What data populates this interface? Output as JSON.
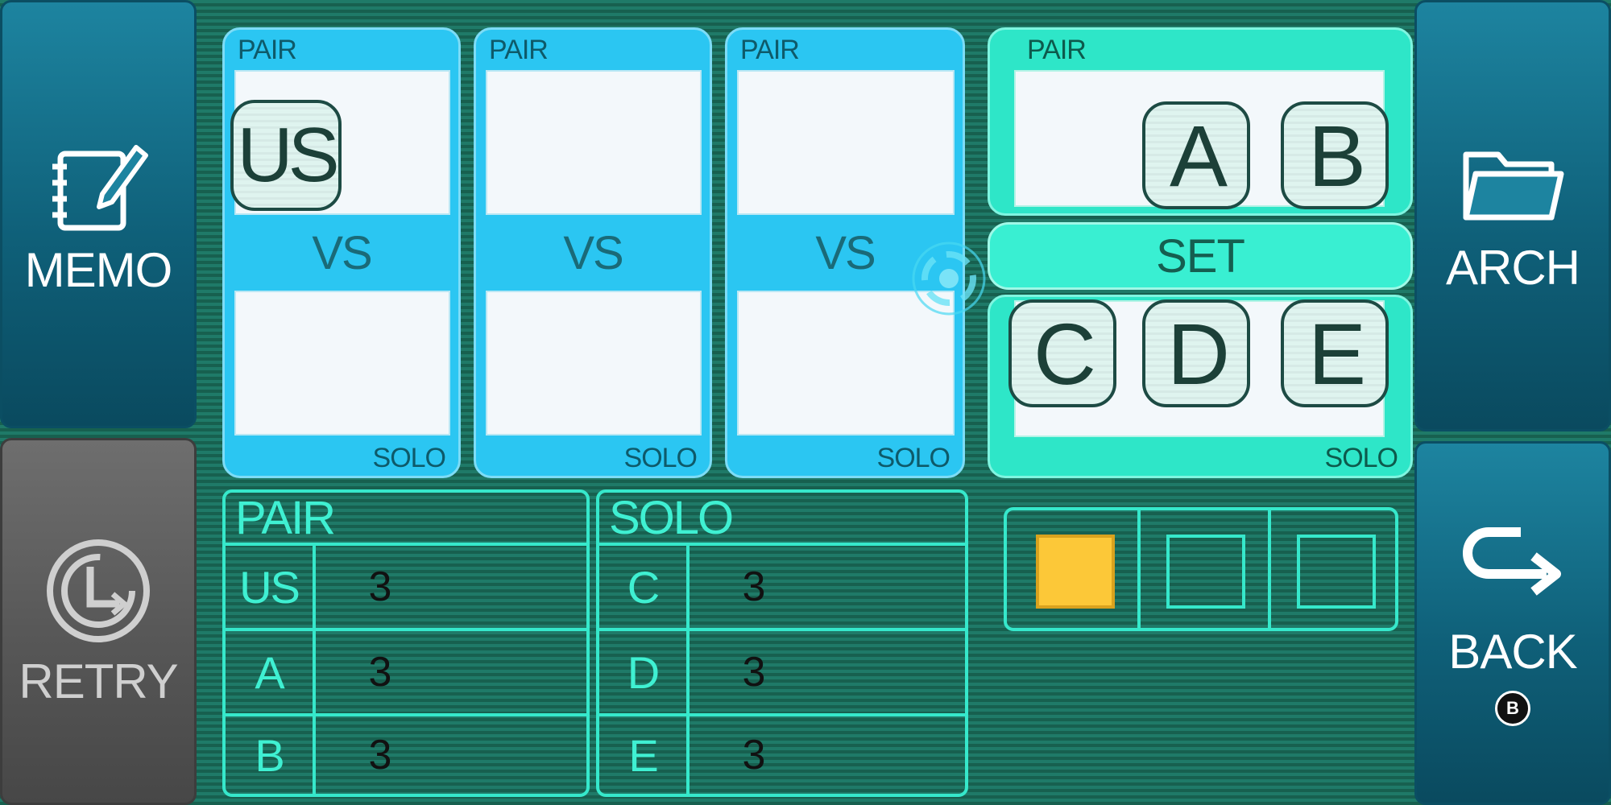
{
  "side_buttons": {
    "memo": {
      "label": "MEMO",
      "icon": "memo-notebook-icon"
    },
    "retry": {
      "label": "RETRY",
      "icon": "retry-clock-icon"
    },
    "arch": {
      "label": "ARCH",
      "icon": "folder-icon"
    },
    "back": {
      "label": "BACK",
      "icon": "return-arrow-icon",
      "button_hint": "B"
    }
  },
  "matches": [
    {
      "top_label": "PAIR",
      "vs_label": "VS",
      "bottom_label": "SOLO",
      "pair_tiles": [
        "US"
      ],
      "solo_tiles": []
    },
    {
      "top_label": "PAIR",
      "vs_label": "VS",
      "bottom_label": "SOLO",
      "pair_tiles": [],
      "solo_tiles": []
    },
    {
      "top_label": "PAIR",
      "vs_label": "VS",
      "bottom_label": "SOLO",
      "pair_tiles": [],
      "solo_tiles": []
    }
  ],
  "pool": {
    "top_label": "PAIR",
    "set_label": "SET",
    "bottom_label": "SOLO",
    "pair_tiles": [
      "A",
      "B"
    ],
    "solo_tiles": [
      "C",
      "D",
      "E"
    ]
  },
  "pair_table": {
    "header": "PAIR",
    "rows": [
      {
        "name": "US",
        "value": "3"
      },
      {
        "name": "A",
        "value": "3"
      },
      {
        "name": "B",
        "value": "3"
      }
    ]
  },
  "solo_table": {
    "header": "SOLO",
    "rows": [
      {
        "name": "C",
        "value": "3"
      },
      {
        "name": "D",
        "value": "3"
      },
      {
        "name": "E",
        "value": "3"
      }
    ]
  },
  "rounds": {
    "total": 3,
    "filled": 1,
    "fill_color": "#fcc838"
  },
  "colors": {
    "panel_blue": "#2bc6f2",
    "panel_teal": "#2ee6c8",
    "grid_line": "#36e8cb",
    "background": "#1f7a68"
  }
}
